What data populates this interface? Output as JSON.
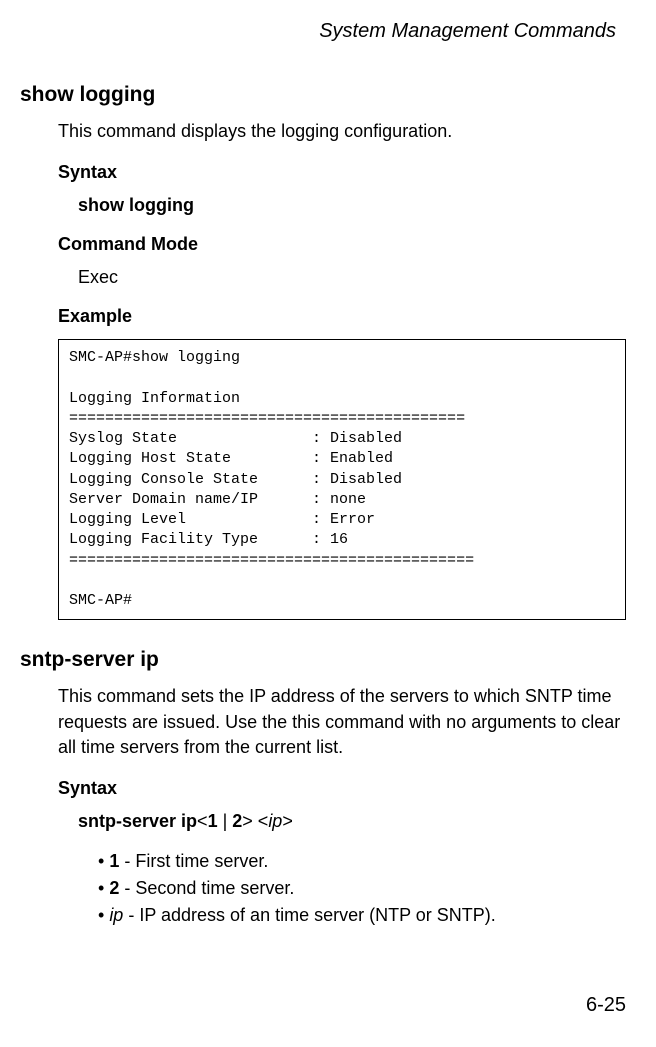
{
  "header": {
    "title": "System Management Commands"
  },
  "section1": {
    "title": "show logging",
    "description": "This command displays the logging configuration.",
    "syntax_heading": "Syntax",
    "syntax_text": "show logging",
    "mode_heading": "Command Mode",
    "mode_text": "Exec",
    "example_heading": "Example",
    "code": "SMC-AP#show logging\n\nLogging Information\n============================================\nSyslog State               : Disabled\nLogging Host State         : Enabled\nLogging Console State      : Disabled\nServer Domain name/IP      : none\nLogging Level              : Error\nLogging Facility Type      : 16\n=============================================\n\nSMC-AP#"
  },
  "section2": {
    "title": "sntp-server ip",
    "description": "This command sets the IP address of the servers to which SNTP time requests are issued. Use the this command with no arguments to clear all time servers from the current list.",
    "syntax_heading": "Syntax",
    "syntax_prefix": "sntp-server ip",
    "syntax_lt1": "<",
    "syntax_n1": "1",
    "syntax_pipe": " | ",
    "syntax_n2": "2",
    "syntax_gt1": ">",
    "syntax_lt2": " <",
    "syntax_ip": "ip",
    "syntax_gt2": ">",
    "bullets": {
      "b1_bold": "1",
      "b1_text": " - First time server.",
      "b2_bold": "2",
      "b2_text": " - Second time server.",
      "b3_italic": "ip",
      "b3_text": " - IP address of an time server (NTP or SNTP)."
    }
  },
  "page_number": "6-25"
}
